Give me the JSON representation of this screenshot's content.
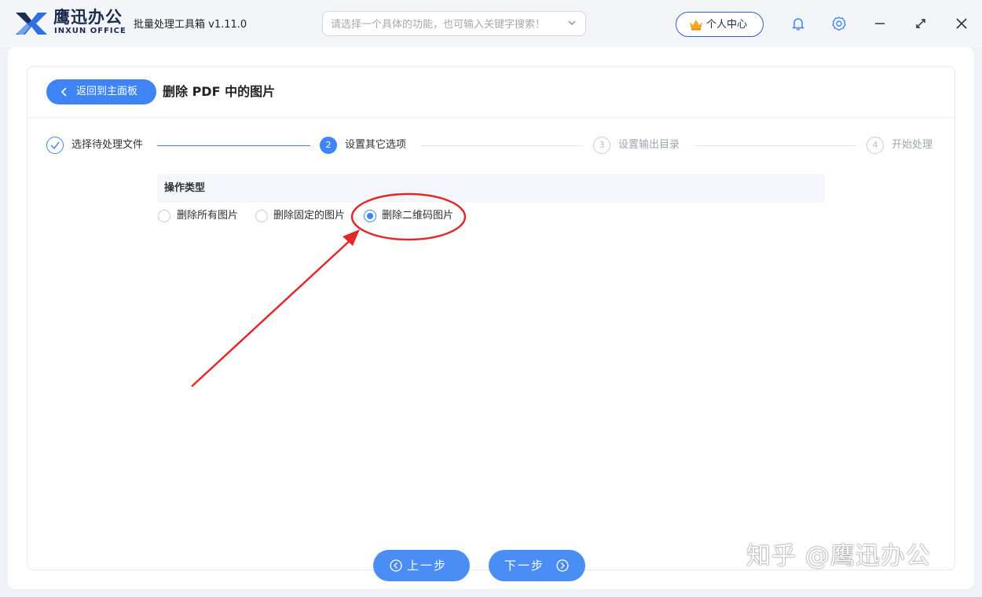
{
  "app": {
    "brand_cn": "鹰迅办公",
    "brand_en": "INXUN OFFICE",
    "title": "批量处理工具箱 v1.11.0",
    "search_placeholder": "请选择一个具体的功能，也可输入关键字搜索！",
    "user_center_label": "个人中心"
  },
  "header": {
    "back_label": "返回到主面板",
    "page_title": "删除 PDF 中的图片"
  },
  "steps": [
    {
      "number": "1",
      "label": "选择待处理文件",
      "state": "done"
    },
    {
      "number": "2",
      "label": "设置其它选项",
      "state": "active"
    },
    {
      "number": "3",
      "label": "设置输出目录",
      "state": "pending"
    },
    {
      "number": "4",
      "label": "开始处理",
      "state": "pending"
    }
  ],
  "options": {
    "section_title": "操作类型",
    "choices": [
      {
        "label": "删除所有图片",
        "selected": false
      },
      {
        "label": "删除固定的图片",
        "selected": false
      },
      {
        "label": "删除二维码图片",
        "selected": true
      }
    ]
  },
  "footer": {
    "prev_label": "上一步",
    "next_label": "下一步"
  },
  "watermark": "知乎 @鹰迅办公",
  "colors": {
    "accent": "#3f84f4",
    "annotation": "#e02a2a",
    "brand": "#1d2b4f"
  }
}
